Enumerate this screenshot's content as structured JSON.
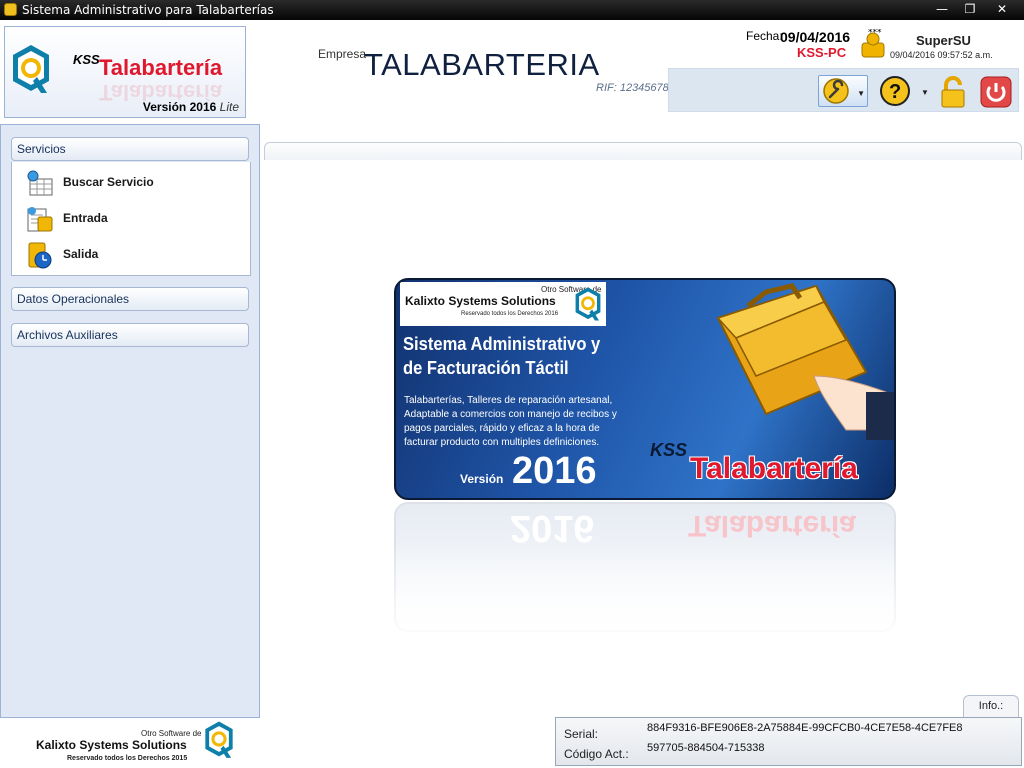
{
  "window": {
    "title": "Sistema Administrativo para Talabarterías",
    "min_icon": "minimize-icon",
    "restore_icon": "restore-icon",
    "close_icon": "close-icon"
  },
  "header": {
    "logo": {
      "kss": "KSS",
      "brand": "Talabartería",
      "version": "Versión 2016",
      "edition": "Lite"
    },
    "empresa_label": "Empresa",
    "company_name": "TALABARTERIA",
    "rif": "RIF: 12345678",
    "fecha_label": "Fecha:",
    "fecha_value": "09/04/2016",
    "pc_name": "KSS-PC",
    "user_name": "SuperSU",
    "login_time": "09/04/2016  09:57:52 a.m.",
    "user_badge": "***"
  },
  "toolbar": {
    "tools_icon": "wrench-icon",
    "help_icon": "help-icon",
    "lock_icon": "lock-icon",
    "power_icon": "power-icon"
  },
  "sidebar": {
    "groups": [
      {
        "label": "Servicios",
        "expanded": true
      },
      {
        "label": "Datos Operacionales",
        "expanded": false
      },
      {
        "label": "Archivos Auxiliares",
        "expanded": false
      }
    ],
    "items": [
      {
        "label": "Buscar Servicio",
        "icon": "search-service-icon"
      },
      {
        "label": "Entrada",
        "icon": "entry-icon"
      },
      {
        "label": "Salida",
        "icon": "exit-icon"
      }
    ],
    "footer": {
      "small": "Otro Software de",
      "name": "Kalixto Systems Solutions",
      "rights": "Reservado todos los Derechos 2015"
    }
  },
  "banner": {
    "otro": "Otro Software de",
    "company": "Kalixto Systems Solutions",
    "reserved": "Reservado todos los Derechos 2016",
    "headline": "Sistema Administrativo y de Facturación Táctil",
    "description": "Talabarterías, Talleres de reparación artesanal, Adaptable a comercios con manejo de recibos y pagos parciales, rápido y eficaz a la hora de facturar producto con multiples definiciones.",
    "version_label": "Versión",
    "version_year": "2016",
    "kss": "KSS",
    "brand": "Talabartería"
  },
  "info": {
    "tab_label": "Info.:",
    "serial_label": "Serial:",
    "serial_value": "884F9316-BFE906E8-2A75884E-99CFCB0-4CE7E58-4CE7FE8",
    "code_label": "Código Act.:",
    "code_value": "597705-884504-715338"
  },
  "colors": {
    "brand_red": "#e0182d",
    "sidebar_bg": "#dfe8f4",
    "toolbar_bg": "#dce6f1",
    "banner_blue": "#1f55a8"
  }
}
